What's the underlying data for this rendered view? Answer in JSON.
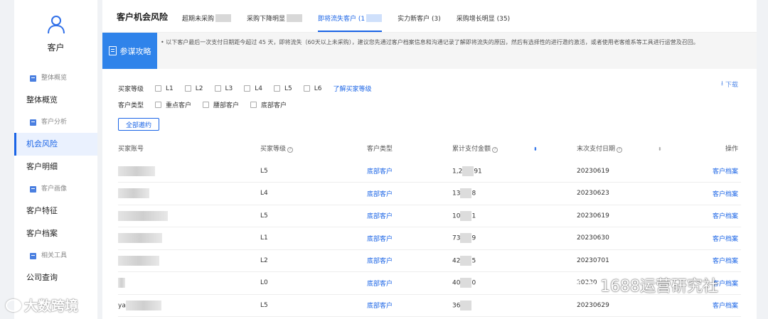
{
  "sidebar": {
    "title": "客户",
    "items": [
      {
        "label": "整体概览",
        "type": "sub"
      },
      {
        "label": "整体概览",
        "type": "main"
      },
      {
        "label": "客户分析",
        "type": "sub"
      },
      {
        "label": "机会风险",
        "type": "main",
        "active": true
      },
      {
        "label": "客户明细",
        "type": "main"
      },
      {
        "label": "客户画像",
        "type": "sub"
      },
      {
        "label": "客户特征",
        "type": "main"
      },
      {
        "label": "客户档案",
        "type": "main"
      },
      {
        "label": "相关工具",
        "type": "sub"
      },
      {
        "label": "公司查询",
        "type": "main"
      }
    ]
  },
  "tabs": {
    "title": "客户机会风险",
    "items": [
      "超期未采购",
      "采购下降明显",
      "即将流失客户 (1",
      "实力新客户 (3)",
      "采购增长明显 (35)"
    ]
  },
  "strategy": {
    "button": "参谋攻略",
    "text": "• 以下客户最后一次支付日期距今超过 45 天，即将流失（60天以上未采购），建议您先通过客户档案信息和沟通记录了解即将流失的原因，然后有选择性的进行邀约激活，或者使用老客维系等工具进行运营及召回。"
  },
  "filters": {
    "level_label": "买家等级",
    "levels": [
      "L1",
      "L2",
      "L3",
      "L4",
      "L5",
      "L6"
    ],
    "level_link": "了解买家等级",
    "type_label": "客户类型",
    "types": [
      "重点客户",
      "腰部客户",
      "底部客户"
    ],
    "download": "下载",
    "invite_all": "全部邀约"
  },
  "table": {
    "headers": [
      "买家账号",
      "买家等级",
      "客户类型",
      "累计支付金额",
      "末次支付日期",
      "操作"
    ],
    "rows": [
      {
        "account": "",
        "level": "L5",
        "type": "底部客户",
        "amount_prefix": "1,2",
        "amount_suffix": "91",
        "date": "20230619",
        "action": "客户档案"
      },
      {
        "account": "",
        "level": "L4",
        "type": "底部客户",
        "amount_prefix": "13",
        "amount_suffix": "8",
        "date": "20230623",
        "action": "客户档案"
      },
      {
        "account": "",
        "level": "L5",
        "type": "底部客户",
        "amount_prefix": "10",
        "amount_suffix": "1",
        "date": "20230619",
        "action": "客户档案"
      },
      {
        "account": "",
        "level": "L1",
        "type": "底部客户",
        "amount_prefix": "73",
        "amount_suffix": "9",
        "date": "20230630",
        "action": "客户档案"
      },
      {
        "account": "",
        "level": "L2",
        "type": "底部客户",
        "amount_prefix": "42",
        "amount_suffix": "5",
        "date": "20230701",
        "action": "客户档案"
      },
      {
        "account": "",
        "level": "L0",
        "type": "底部客户",
        "amount_prefix": "40",
        "amount_suffix": "0",
        "date": "20230",
        "action": "客户档案"
      },
      {
        "account": "ya",
        "level": "L5",
        "type": "底部客户",
        "amount_prefix": "36",
        "amount_suffix": "",
        "date": "20230629",
        "action": "客户档案"
      }
    ]
  },
  "watermarks": {
    "left": "大数跨境",
    "right": "1688运营研究社"
  }
}
